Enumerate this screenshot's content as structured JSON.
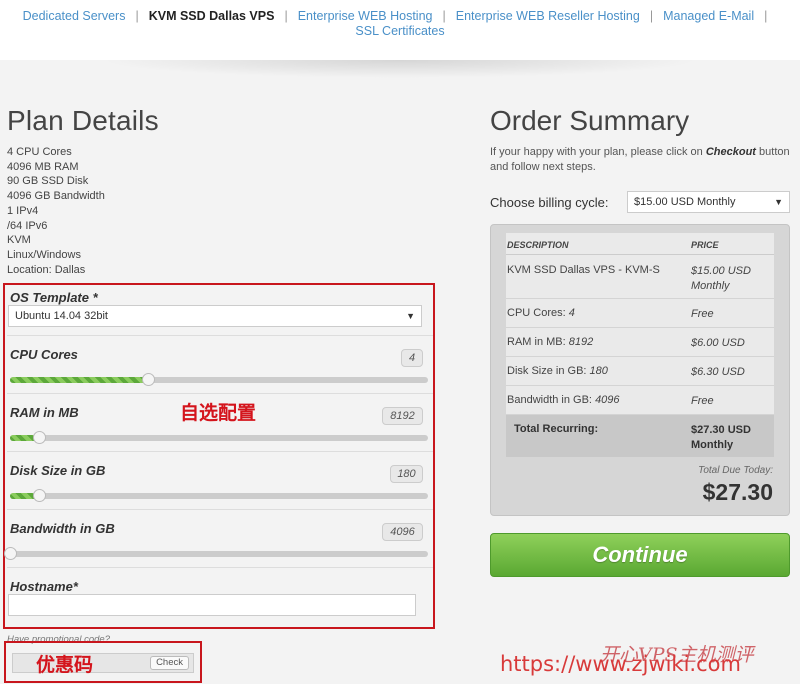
{
  "nav": {
    "items": [
      {
        "label": "Dedicated Servers",
        "active": false
      },
      {
        "label": "KVM SSD Dallas VPS",
        "active": true
      },
      {
        "label": "Enterprise WEB Hosting",
        "active": false
      },
      {
        "label": "Enterprise WEB Reseller Hosting",
        "active": false
      },
      {
        "label": "Managed E-Mail",
        "active": false
      }
    ],
    "second_row": "SSL Certificates"
  },
  "plan": {
    "title": "Plan Details",
    "specs": [
      "4 CPU Cores",
      "4096 MB RAM",
      "90 GB SSD Disk",
      "4096 GB Bandwidth",
      "1 IPv4",
      "/64 IPv6",
      "KVM",
      "Linux/Windows",
      "Location: Dallas"
    ]
  },
  "config": {
    "os_label": "OS Template *",
    "os_value": "Ubuntu 14.04 32bit",
    "annotation": "自选配置",
    "sliders": [
      {
        "label": "CPU Cores",
        "value": "4",
        "fill_percent": 33
      },
      {
        "label": "RAM in MB",
        "value": "8192",
        "fill_percent": 7
      },
      {
        "label": "Disk Size in GB",
        "value": "180",
        "fill_percent": 7
      },
      {
        "label": "Bandwidth in GB",
        "value": "4096",
        "fill_percent": 0
      }
    ],
    "hostname_label": "Hostname*"
  },
  "promo": {
    "label": "Have promotional code?",
    "check_label": "Check",
    "annotation": "优惠码"
  },
  "summary": {
    "title": "Order Summary",
    "intro_prefix": "If your happy with your plan, please click on ",
    "intro_bold": "Checkout",
    "intro_suffix": " button and follow next steps.",
    "billing_label": "Choose billing cycle:",
    "billing_value": "$15.00 USD Monthly",
    "col_description": "DESCRIPTION",
    "col_price": "PRICE",
    "rows": [
      {
        "desc": "KVM SSD Dallas VPS - KVM-S",
        "desc_value": "",
        "price": "$15.00 USD Monthly"
      },
      {
        "desc": "CPU Cores: ",
        "desc_value": "4",
        "price": "Free"
      },
      {
        "desc": "RAM in MB: ",
        "desc_value": "8192",
        "price": "$6.00 USD"
      },
      {
        "desc": "Disk Size in GB: ",
        "desc_value": "180",
        "price": "$6.30 USD"
      },
      {
        "desc": "Bandwidth in GB: ",
        "desc_value": "4096",
        "price": "Free"
      }
    ],
    "total_label": "Total Recurring:",
    "total_value": "$27.30 USD Monthly",
    "due_label": "Total Due Today:",
    "due_amount": "$27.30",
    "continue_label": "Continue"
  },
  "watermark": {
    "url": "https://www.zjwiki.com",
    "cn": "开心VPS主机测评"
  },
  "colors": {
    "link": "#4a90c8",
    "annotation_red": "#c8161d",
    "continue_green": "#6cba3f"
  }
}
